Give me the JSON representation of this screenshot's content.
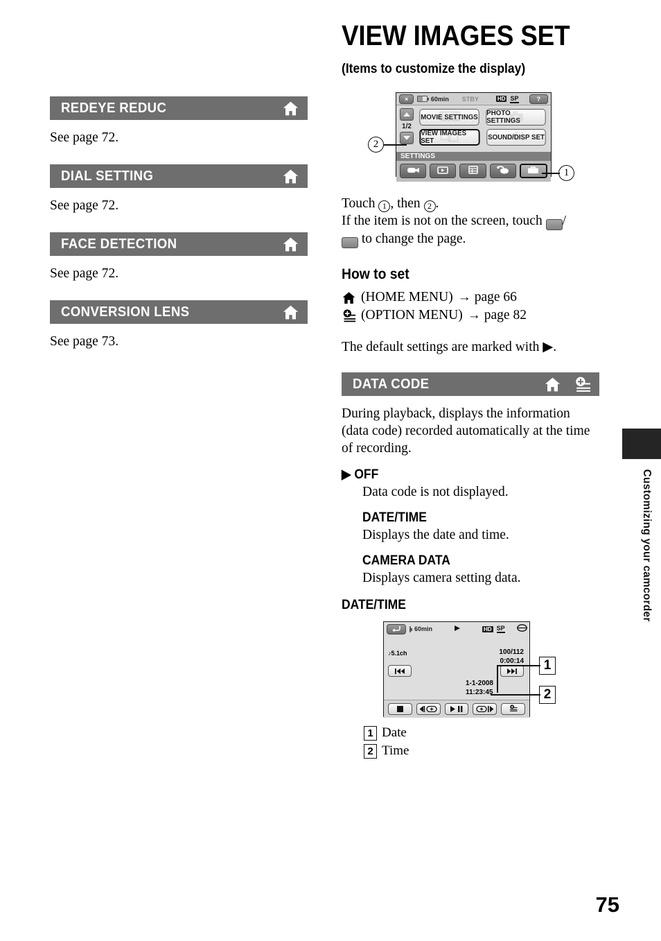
{
  "page": {
    "number": "75",
    "side_tab_text": "Customizing your camcorder"
  },
  "title": {
    "heading": "VIEW IMAGES SET",
    "subtitle": "(Items to customize the display)"
  },
  "left_column": {
    "sections": [
      {
        "title": "REDEYE REDUC",
        "icons": [
          "home-icon"
        ],
        "body": "See page 72."
      },
      {
        "title": "DIAL SETTING",
        "icons": [
          "home-icon"
        ],
        "body": "See page 72."
      },
      {
        "title": "FACE DETECTION",
        "icons": [
          "home-icon"
        ],
        "body": "See page 72."
      },
      {
        "title": "CONVERSION LENS",
        "icons": [
          "home-icon"
        ],
        "body": "See page 73."
      }
    ]
  },
  "menu_screen": {
    "status_bar": {
      "close_label": "×",
      "battery": "60min",
      "mode": "STBY",
      "quality_hd": "HD",
      "quality_sp": "SP",
      "help_label": "?"
    },
    "page_indicator": "1/2",
    "buttons": [
      {
        "label": "MOVIE SETTINGS",
        "watermark": "film-icon",
        "selected": false
      },
      {
        "label": "PHOTO SETTINGS",
        "watermark": "camera-icon",
        "selected": false
      },
      {
        "label": "VIEW IMAGES SET",
        "watermark": "frames-icon",
        "selected": true
      },
      {
        "label": "SOUND/DISP SET",
        "watermark": "speaker-icon",
        "selected": false
      }
    ],
    "category_label": "SETTINGS",
    "tabs": [
      {
        "icon": "camcorder-icon",
        "selected": false
      },
      {
        "icon": "playback-icon",
        "selected": false
      },
      {
        "icon": "manage-media-icon",
        "selected": false
      },
      {
        "icon": "others-icon",
        "selected": false
      },
      {
        "icon": "settings-toolbox-icon",
        "selected": true
      }
    ],
    "callouts": {
      "one": "1",
      "two": "2"
    }
  },
  "instructions": {
    "line1_pre": "Touch ",
    "line1_mid": ", then ",
    "line1_end": ".",
    "callout_one": "1",
    "callout_two": "2",
    "line2_pre": "If the item is not on the screen, touch ",
    "line2_slash": "/",
    "line2_end": " to change the page."
  },
  "how_to_set": {
    "heading": "How to set",
    "home_menu": "(HOME MENU)",
    "home_page": "page 66",
    "option_menu": "(OPTION MENU)",
    "option_page": "page 82",
    "arrow": "→",
    "default_note": "The default settings are marked with ▶."
  },
  "data_code": {
    "title": "DATA CODE",
    "icons": [
      "home-icon",
      "option-menu-icon"
    ],
    "description": "During playback, displays the information (data code) recorded automatically at the time of recording.",
    "options": [
      {
        "label": "OFF",
        "default": true,
        "desc": "Data code is not displayed."
      },
      {
        "label": "DATE/TIME",
        "default": false,
        "desc": "Displays the date and time."
      },
      {
        "label": "CAMERA DATA",
        "default": false,
        "desc": "Displays camera setting data."
      }
    ],
    "example_heading": "DATE/TIME"
  },
  "playback_screen": {
    "status_bar": {
      "return_label": "return-icon",
      "battery": "60min",
      "play_indicator": "play-icon",
      "quality_hd": "HD",
      "quality_sp": "SP",
      "media_icon": "disc-icon"
    },
    "audio": "♪5.1ch",
    "counter": "100/112",
    "timecode": "0:00:14",
    "date": "1-1-2008",
    "time": "11:23:45",
    "prev_button": "prev-icon",
    "next_button": "next-icon",
    "bottom_buttons": [
      "stop-icon",
      "frame-reverse-icon",
      "play-pause-icon",
      "frame-advance-icon",
      "option-menu-icon"
    ],
    "callouts": {
      "one": "1",
      "two": "2"
    }
  },
  "legend": [
    {
      "num": "1",
      "label": "Date"
    },
    {
      "num": "2",
      "label": "Time"
    }
  ]
}
